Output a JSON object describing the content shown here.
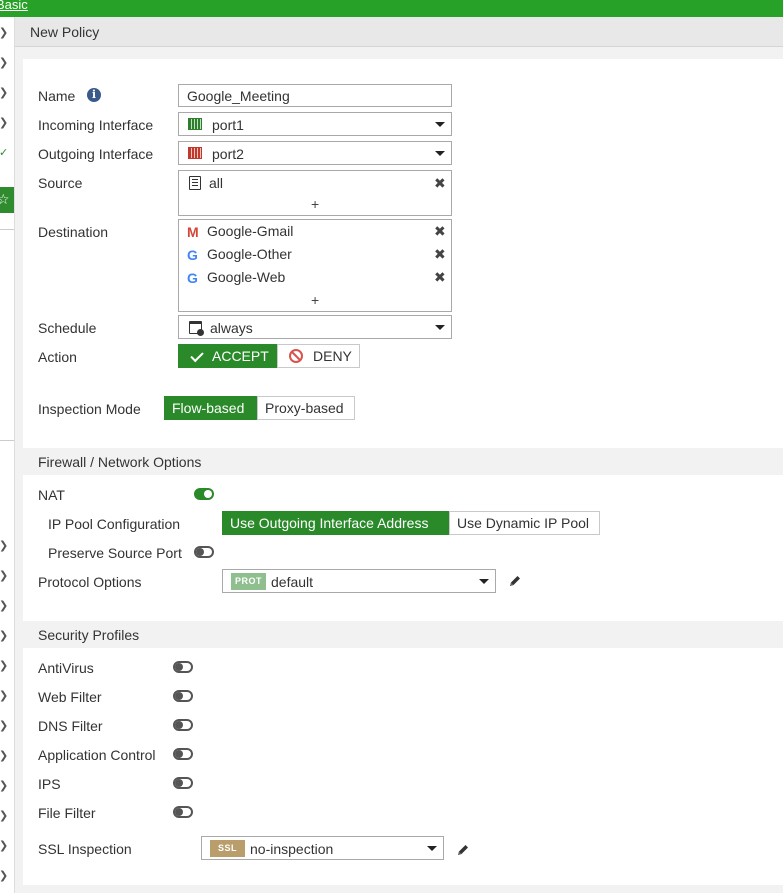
{
  "window": {
    "crumb": "Basic"
  },
  "page": {
    "title": "New Policy"
  },
  "form": {
    "name": {
      "label": "Name",
      "value": "Google_Meeting"
    },
    "incoming": {
      "label": "Incoming Interface",
      "value": "port1"
    },
    "outgoing": {
      "label": "Outgoing Interface",
      "value": "port2"
    },
    "source": {
      "label": "Source",
      "items": [
        "all"
      ],
      "add": "+"
    },
    "destination": {
      "label": "Destination",
      "items": [
        "Google-Gmail",
        "Google-Other",
        "Google-Web"
      ],
      "add": "+"
    },
    "schedule": {
      "label": "Schedule",
      "value": "always"
    },
    "action": {
      "label": "Action",
      "options": [
        "ACCEPT",
        "DENY"
      ],
      "selected": "ACCEPT"
    },
    "inspection_mode": {
      "label": "Inspection Mode",
      "options": [
        "Flow-based",
        "Proxy-based"
      ],
      "selected": "Flow-based"
    }
  },
  "firewall": {
    "title": "Firewall / Network Options",
    "nat": {
      "label": "NAT",
      "enabled": true
    },
    "ip_pool": {
      "label": "IP Pool Configuration",
      "options": [
        "Use Outgoing Interface Address",
        "Use Dynamic IP Pool"
      ],
      "selected": "Use Outgoing Interface Address"
    },
    "preserve_port": {
      "label": "Preserve Source Port",
      "enabled": false
    },
    "protocol_options": {
      "label": "Protocol Options",
      "badge": "PROT",
      "value": "default"
    }
  },
  "security": {
    "title": "Security Profiles",
    "profiles": [
      {
        "label": "AntiVirus",
        "enabled": false
      },
      {
        "label": "Web Filter",
        "enabled": false
      },
      {
        "label": "DNS Filter",
        "enabled": false
      },
      {
        "label": "Application Control",
        "enabled": false
      },
      {
        "label": "IPS",
        "enabled": false
      },
      {
        "label": "File Filter",
        "enabled": false
      }
    ],
    "ssl": {
      "label": "SSL Inspection",
      "badge": "SSL",
      "value": "no-inspection"
    }
  },
  "icons": {
    "info": "info-icon",
    "port_in": "port-green-icon",
    "port_out": "port-red-icon",
    "address": "address-icon",
    "google": "google-icon",
    "gmail": "gmail-icon",
    "schedule": "schedule-icon",
    "remove": "close-icon",
    "edit": "pencil-icon",
    "accent": "#2a8a2a"
  }
}
